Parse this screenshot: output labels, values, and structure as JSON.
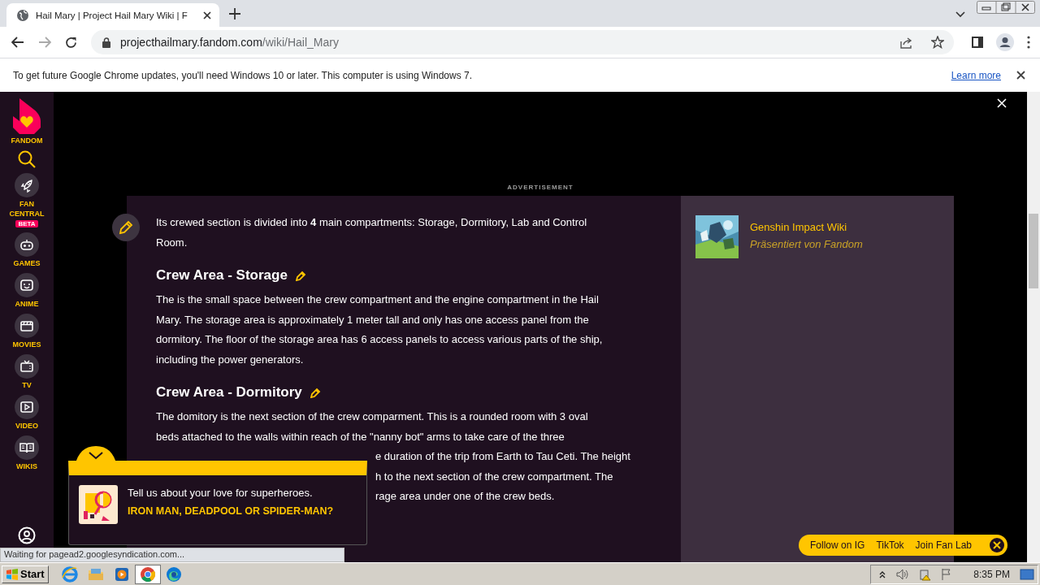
{
  "browser": {
    "tab_title": "Hail Mary | Project Hail Mary Wiki | F",
    "url_host": "projecthailmary.fandom.com",
    "url_path": "/wiki/Hail_Mary",
    "infobar": {
      "message": "To get future Google Chrome updates, you'll need Windows 10 or later. This computer is using Windows 7.",
      "link": "Learn more"
    }
  },
  "sidebar": {
    "logo_label": "FANDOM",
    "items": [
      {
        "kind": "rocket",
        "label": "FAN CENTRAL",
        "badge": "BETA"
      },
      {
        "kind": "gamepad",
        "label": "GAMES"
      },
      {
        "kind": "face",
        "label": "ANIME"
      },
      {
        "kind": "clapper",
        "label": "MOVIES"
      },
      {
        "kind": "tv",
        "label": "TV"
      },
      {
        "kind": "play",
        "label": "VIDEO"
      },
      {
        "kind": "book",
        "label": "WIKIS"
      }
    ]
  },
  "ad": {
    "label": "ADVERTISEMENT"
  },
  "article": {
    "intro": "Its crewed section is divided into **4** main compartments: Storage, Dormitory, Lab and Control Room.",
    "sections": [
      {
        "heading": "Crew Area - Storage",
        "lines": [
          {
            "text": "The is the small space between the crew compartment and the engine compartment in the Hail",
            "covered": false
          },
          {
            "text": "Mary. The storage area is approximately 1 meter tall and only has one access panel from the",
            "covered": false
          },
          {
            "text": "dormitory. The floor of the storage area has 6 access panels to access various parts of the ship,",
            "covered": false
          },
          {
            "text": "including the power generators.",
            "covered": false
          }
        ]
      },
      {
        "heading": "Crew Area - Dormitory",
        "lines": [
          {
            "text": "The domitory is the next section of the crew comparment. This is a rounded room with 3 oval",
            "covered": false
          },
          {
            "text": "beds attached to the walls within reach of the \"nanny bot\" arms to take care of the three",
            "covered": false
          },
          {
            "text": "e duration of the trip from Earth to Tau Ceti. The height",
            "covered": true
          },
          {
            "text": "h to the next section of the crew compartment. The",
            "covered": true
          },
          {
            "text": "rage area under one of the crew beds.",
            "covered": true
          }
        ]
      }
    ]
  },
  "popular": {
    "items": [
      {
        "title": "Genshin Impact Wiki",
        "subtitle": "Präsentiert von Fandom"
      }
    ]
  },
  "popup": {
    "text": "Tell us about your love for superheroes.",
    "question": "IRON MAN, DEADPOOL OR SPIDER-MAN?"
  },
  "follow_bar": {
    "links": [
      "Follow on IG",
      "TikTok",
      "Join Fan Lab"
    ]
  },
  "status_text": "Waiting for pagead2.googlesyndication.com...",
  "taskbar": {
    "start": "Start",
    "apps": [
      {
        "kind": "ie",
        "selected": false
      },
      {
        "kind": "folder",
        "selected": false
      },
      {
        "kind": "media",
        "selected": false
      },
      {
        "kind": "chrome",
        "selected": true
      },
      {
        "kind": "edge",
        "selected": false
      }
    ],
    "clock": "8:35 PM"
  }
}
